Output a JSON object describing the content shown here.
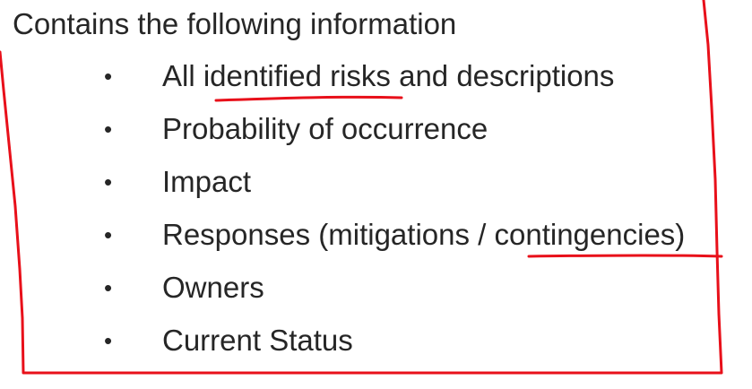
{
  "heading": "Contains the following information",
  "bullet_glyph": "•",
  "items": [
    {
      "text": "All identified risks and descriptions"
    },
    {
      "text": "Probability of occurrence"
    },
    {
      "text": "Impact"
    },
    {
      "text": "Responses (mitigations / contingencies)"
    },
    {
      "text": "Owners"
    },
    {
      "text": "Current Status"
    }
  ],
  "ink_color": "#e8101a"
}
